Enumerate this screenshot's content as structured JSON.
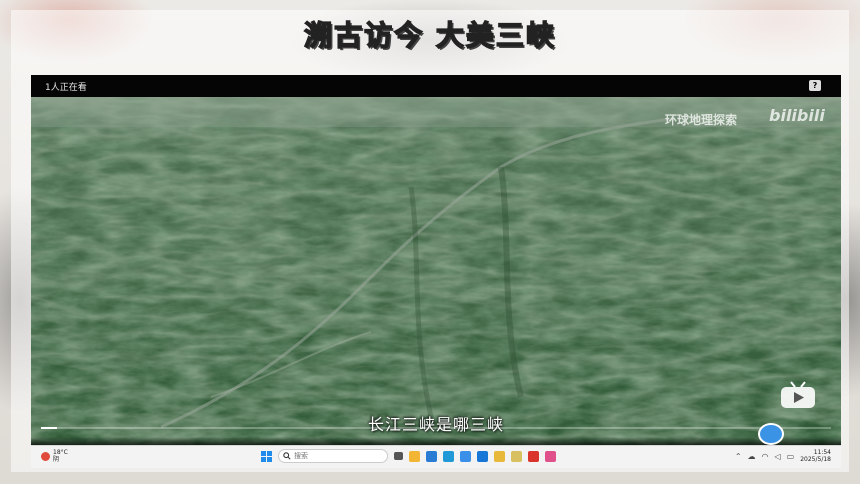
{
  "slide": {
    "title": "溯古访今  大美三峡"
  },
  "video": {
    "viewers": "1人正在看",
    "help_label": "?",
    "watermark": "环球地理探索",
    "brand": "bilibili",
    "subtitle": "长江三峡是哪三峡",
    "progress": 0.02
  },
  "taskbar": {
    "weather_temp": "18°C",
    "weather_desc": "阴",
    "search_placeholder": "搜索",
    "time": "11:54",
    "date": "2025/5/18",
    "apps": [
      {
        "name": "file-explorer-icon",
        "color": "#f2b534"
      },
      {
        "name": "photos-icon",
        "color": "#2a7bd4"
      },
      {
        "name": "edge-icon",
        "color": "#1f9ad6"
      },
      {
        "name": "app-icon-blue",
        "color": "#3a8fe8"
      },
      {
        "name": "app-icon-circle",
        "color": "#1877d6"
      },
      {
        "name": "folder-icon",
        "color": "#e8b83a"
      },
      {
        "name": "app-icon-yellow",
        "color": "#d8c060"
      },
      {
        "name": "wps-icon",
        "color": "#d9332c"
      },
      {
        "name": "app-icon-pink",
        "color": "#e0508a"
      }
    ]
  },
  "colors": {
    "accent": "#3b93e6",
    "terrain": "#3c6a43"
  }
}
